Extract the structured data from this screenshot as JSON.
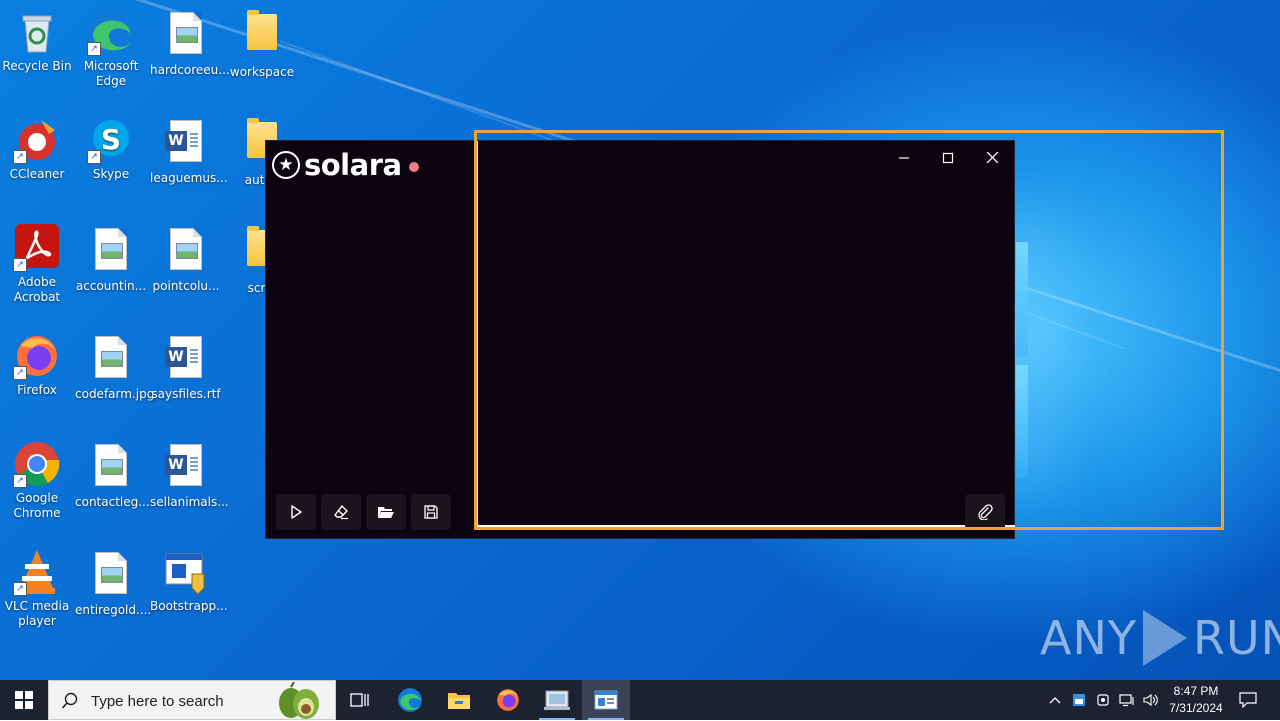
{
  "desktop": {
    "icons": [
      {
        "label": "Recycle Bin",
        "icon": "recycle-bin-icon"
      },
      {
        "label": "Microsoft Edge",
        "icon": "edge-icon"
      },
      {
        "label": "hardcoreeu...",
        "icon": "image-file-icon"
      },
      {
        "label": "workspace",
        "icon": "folder-icon"
      },
      {
        "label": "CCleaner",
        "icon": "ccleaner-icon"
      },
      {
        "label": "Skype",
        "icon": "skype-icon"
      },
      {
        "label": "leaguemus...",
        "icon": "word-doc-icon"
      },
      {
        "label": "autoe",
        "icon": "folder-icon"
      },
      {
        "label": "Adobe Acrobat",
        "icon": "acrobat-icon"
      },
      {
        "label": "accountin...",
        "icon": "image-file-icon"
      },
      {
        "label": "pointcolu...",
        "icon": "image-file-icon"
      },
      {
        "label": "scrip",
        "icon": "folder-icon"
      },
      {
        "label": "Firefox",
        "icon": "firefox-icon"
      },
      {
        "label": "codefarm.jpg",
        "icon": "image-file-icon"
      },
      {
        "label": "saysfiles.rtf",
        "icon": "word-doc-icon"
      },
      {
        "label": "Google Chrome",
        "icon": "chrome-icon"
      },
      {
        "label": "contactleg...",
        "icon": "image-file-icon"
      },
      {
        "label": "sellanimals...",
        "icon": "word-doc-icon"
      },
      {
        "label": "VLC media player",
        "icon": "vlc-icon"
      },
      {
        "label": "entiregold....",
        "icon": "image-file-icon"
      },
      {
        "label": "Bootstrapp...",
        "icon": "installer-icon"
      }
    ]
  },
  "solara": {
    "app_name": "solara",
    "window_controls": {
      "minimize": "—",
      "maximize": "☐",
      "close": "✕"
    },
    "toolbar": [
      {
        "name": "execute",
        "icon": "play-icon"
      },
      {
        "name": "clear",
        "icon": "eraser-icon"
      },
      {
        "name": "open-file",
        "icon": "folder-open-icon"
      },
      {
        "name": "save-file",
        "icon": "save-icon"
      }
    ],
    "attach_icon": "paperclip-icon",
    "editor_content": ""
  },
  "watermark": {
    "left": "ANY",
    "right": "RUN"
  },
  "taskbar": {
    "search_placeholder": "Type here to search",
    "pinned": [
      "task-view-icon",
      "edge-icon",
      "file-explorer-icon",
      "firefox-icon",
      "app-icon",
      "solara-app-icon"
    ],
    "tray_icons": [
      "chevron-up-icon",
      "defender-icon",
      "vpn-icon",
      "network-icon",
      "volume-icon"
    ],
    "time": "8:47 PM",
    "date": "7/31/2024"
  },
  "colors": {
    "desktop_blue": "#0a70d8",
    "solara_bg": "#0c0410",
    "solara_dot": "#f47d86",
    "highlight_orange": "#f0a23a",
    "taskbar": "#1c2230"
  }
}
